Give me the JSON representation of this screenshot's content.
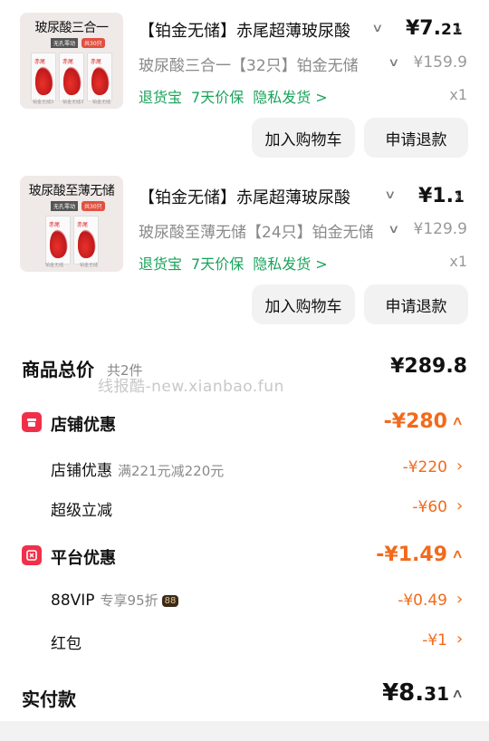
{
  "products": [
    {
      "thumb_title": "玻尿酸三合一",
      "thumb_tag1": "无孔零动",
      "thumb_tag2": "共30只",
      "thumb_box_logo": "赤尾",
      "thumb_foot": [
        "铂金无储3",
        "铂金无储3",
        "铂金无储"
      ],
      "name": "【铂金无储】赤尾超薄玻尿酸",
      "price_int": "¥7.",
      "price_dec": "21",
      "variant": "玻尿酸三合一【32只】铂金无储",
      "original_price": "¥159.9",
      "services": [
        "退货宝",
        "7天价保",
        "隐私发货 >"
      ],
      "qty": "x1",
      "btn_cart": "加入购物车",
      "btn_refund": "申请退款"
    },
    {
      "thumb_title": "玻尿酸至薄无储",
      "thumb_tag1": "无孔零动",
      "thumb_tag2": "共30只",
      "thumb_box_logo": "赤尾",
      "thumb_foot": [
        "铂金无储",
        "铂金无储"
      ],
      "name": "【铂金无储】赤尾超薄玻尿酸",
      "price_int": "¥1.",
      "price_dec": "1",
      "variant": "玻尿酸至薄无储【24只】铂金无储",
      "original_price": "¥129.9",
      "services": [
        "退货宝",
        "7天价保",
        "隐私发货 >"
      ],
      "qty": "x1",
      "btn_cart": "加入购物车",
      "btn_refund": "申请退款"
    }
  ],
  "summary": {
    "total_label": "商品总价",
    "total_count": "共2件",
    "total_value": "¥289.8",
    "watermark": "线报酷-new.xianbao.fun"
  },
  "shop_discount": {
    "title": "店铺优惠",
    "value": "-¥280",
    "items": [
      {
        "label": "店铺优惠",
        "note": "满221元减220元",
        "value": "-¥220"
      },
      {
        "label": "超级立减",
        "note": "",
        "value": "-¥60"
      }
    ]
  },
  "platform_discount": {
    "title": "平台优惠",
    "value": "-¥1.49",
    "items": [
      {
        "label": "88VIP",
        "note": "专享95折",
        "badge": "88",
        "value": "-¥0.49"
      },
      {
        "label": "红包",
        "note": "",
        "value": "-¥1"
      }
    ]
  },
  "payment": {
    "label": "实付款",
    "value_int": "¥8.",
    "value_dec": "31"
  },
  "colors": {
    "accent_orange": "#f26a1b",
    "service_green": "#19a35a",
    "discount_icon_red": "#f0304a"
  }
}
